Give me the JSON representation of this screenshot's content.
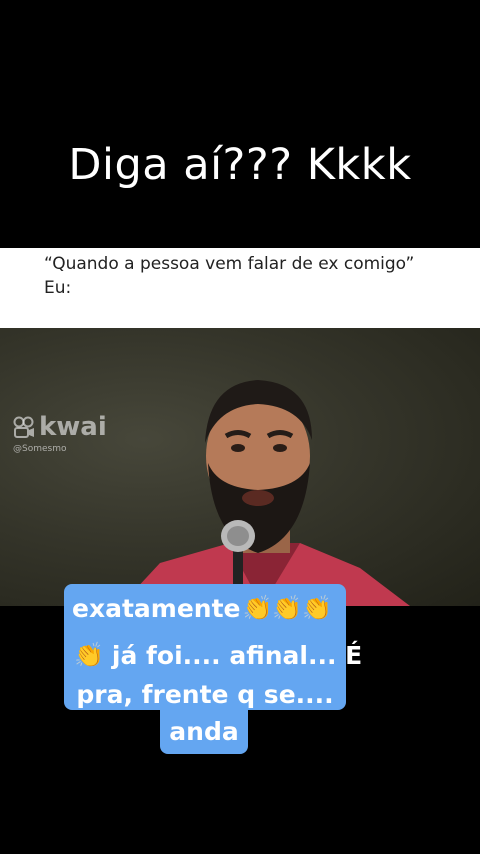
{
  "title": "Diga aí??? Kkkk",
  "meme": {
    "line1": "“Quando a pessoa vem falar de ex comigo”",
    "line2": "Eu:"
  },
  "watermark": {
    "brand": "kwai",
    "handle": "@Somesmo",
    "icon": "kwai-logo-icon"
  },
  "caption": {
    "line1": "exatamente",
    "line1_emoji": "👏👏👏",
    "line2_emoji": "👏",
    "line2": "já foi.... afinal... É",
    "line3": "pra, frente q se....",
    "line4": "anda"
  }
}
